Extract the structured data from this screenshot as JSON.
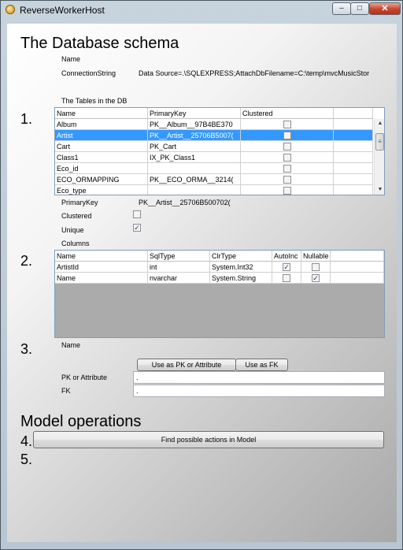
{
  "window": {
    "title": "ReverseWorkerHost",
    "min_glyph": "–",
    "max_glyph": "□",
    "close_glyph": "✕"
  },
  "db_section": {
    "heading": "The Database schema",
    "name_label": "Name",
    "connection_label": "ConnectionString",
    "connection_value": "Data Source=.\\SQLEXPRESS;AttachDbFilename=C:\\temp\\mvcMusicStor",
    "tables_label": "The Tables in the DB"
  },
  "step_numbers": [
    "1.",
    "2.",
    "3.",
    "4.",
    "5."
  ],
  "tables_grid": {
    "columns": [
      "Name",
      "PrimaryKey",
      "Clustered"
    ],
    "rows": [
      {
        "name": "Album",
        "pk": "PK__Album__97B4BE370",
        "clustered": false,
        "selected": false
      },
      {
        "name": "Artist",
        "pk": "PK__Artist__25706B5007(",
        "clustered": false,
        "selected": true
      },
      {
        "name": "Cart",
        "pk": "PK_Cart",
        "clustered": false,
        "selected": false
      },
      {
        "name": "Class1",
        "pk": "IX_PK_Class1",
        "clustered": false,
        "selected": false
      },
      {
        "name": "Eco_id",
        "pk": "",
        "clustered": false,
        "selected": false
      },
      {
        "name": "ECO_ORMAPPING",
        "pk": "PK__ECO_ORMA__3214(",
        "clustered": false,
        "selected": false
      },
      {
        "name": "Eco_type",
        "pk": "",
        "clustered": false,
        "selected": false
      }
    ],
    "scroll_up": "▲",
    "scroll_down": "▼",
    "scroll_grip": "≡"
  },
  "pk_section": {
    "primarykey_label": "PrimaryKey",
    "primarykey_value": "PK__Artist__25706B500702(",
    "clustered_label": "Clustered",
    "clustered_checked": false,
    "unique_label": "Unique",
    "unique_checked": true,
    "columns_label": "Columns"
  },
  "columns_grid": {
    "columns": [
      "Name",
      "SqlType",
      "ClrType",
      "AutoInc",
      "Nullable"
    ],
    "rows": [
      {
        "name": "ArtistId",
        "sqltype": "int",
        "clrtype": "System.Int32",
        "autoinc": true,
        "nullable": false
      },
      {
        "name": "Name",
        "sqltype": "nvarchar",
        "clrtype": "System.String",
        "autoinc": false,
        "nullable": true
      }
    ]
  },
  "step3": {
    "name_label": "Name",
    "use_pk_button": "Use as PK or Attribute",
    "use_fk_button": "Use as FK",
    "pk_attr_label": "PK or Attribute",
    "pk_attr_value": ".",
    "fk_label": "FK",
    "fk_value": "."
  },
  "model_section": {
    "heading": "Model operations",
    "find_actions_button": "Find possible actions in Model"
  }
}
